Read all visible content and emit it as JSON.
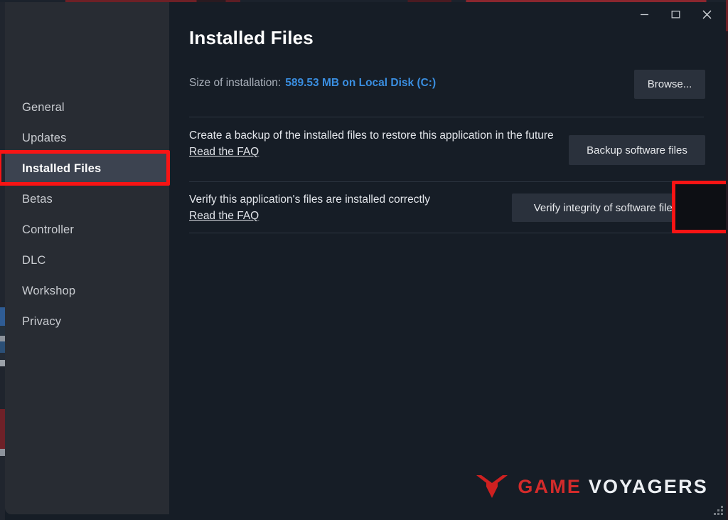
{
  "window": {
    "controls": [
      {
        "name": "minimize",
        "glyph": "minimize-icon"
      },
      {
        "name": "maximize",
        "glyph": "maximize-icon"
      },
      {
        "name": "close",
        "glyph": "close-icon"
      }
    ]
  },
  "sidebar": {
    "items": [
      {
        "label": "General",
        "selected": false
      },
      {
        "label": "Updates",
        "selected": false
      },
      {
        "label": "Installed Files",
        "selected": true
      },
      {
        "label": "Betas",
        "selected": false
      },
      {
        "label": "Controller",
        "selected": false
      },
      {
        "label": "DLC",
        "selected": false
      },
      {
        "label": "Workshop",
        "selected": false
      },
      {
        "label": "Privacy",
        "selected": false
      }
    ]
  },
  "main": {
    "title": "Installed Files",
    "size_label": "Size of installation:",
    "size_value": "589.53 MB on Local Disk (C:)",
    "browse_label": "Browse...",
    "rows": [
      {
        "description": "Create a backup of the installed files to restore this application in the future",
        "link": "Read the FAQ",
        "button": "Backup software files"
      },
      {
        "description": "Verify this application's files are installed correctly",
        "link": "Read the FAQ",
        "button": "Verify integrity of software files"
      }
    ]
  },
  "annotations": {
    "color": "#f81414",
    "targets": [
      "Installed Files",
      "Verify integrity of software files"
    ]
  },
  "watermark": {
    "word1": "GAME",
    "word2": "VOYAGERS",
    "logo": "chevron-logo-icon",
    "color_word1": "#d32b2b",
    "color_word2": "#eceff3"
  },
  "colors": {
    "sidebar_bg": "#282c33",
    "content_bg": "#161d26",
    "selected_bg": "#3c4350",
    "button_bg": "#2a313c",
    "link_blue": "#3a8ee0",
    "annotation_red": "#f81414"
  }
}
